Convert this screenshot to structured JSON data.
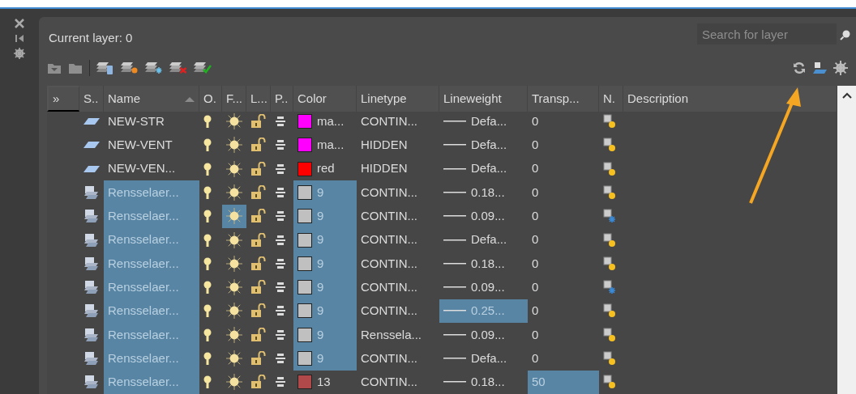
{
  "palette": {
    "current_layer": "Current layer: 0",
    "search": {
      "placeholder": "Search for layer"
    }
  },
  "table": {
    "columns": [
      {
        "label": "»",
        "kind": "expand"
      },
      {
        "label": "S..",
        "kind": "header"
      },
      {
        "label": "Name",
        "kind": "header",
        "sorted": true
      },
      {
        "label": "O.",
        "kind": "header"
      },
      {
        "label": "F...",
        "kind": "header"
      },
      {
        "label": "L...",
        "kind": "header"
      },
      {
        "label": "P..",
        "kind": "header"
      },
      {
        "label": "Color",
        "kind": "header"
      },
      {
        "label": "Linetype",
        "kind": "header"
      },
      {
        "label": "Lineweight",
        "kind": "header"
      },
      {
        "label": "Transp...",
        "kind": "header"
      },
      {
        "label": "N.",
        "kind": "header"
      },
      {
        "label": "Description",
        "kind": "header"
      }
    ],
    "rows": [
      {
        "kind": "layer",
        "name": "NEW-STR",
        "selected": false,
        "on": true,
        "frozen": false,
        "freeze_selected": false,
        "locked": false,
        "plot": true,
        "color": "#ff00ff",
        "color_name": "ma...",
        "color_selected": false,
        "linetype": "CONTIN...",
        "lineweight": "Defa...",
        "lineweight_selected": false,
        "transparency": "0",
        "transparency_selected": false,
        "vp_frozen": false
      },
      {
        "kind": "layer",
        "name": "NEW-VENT",
        "selected": false,
        "on": true,
        "frozen": false,
        "freeze_selected": false,
        "locked": false,
        "plot": true,
        "color": "#ff00ff",
        "color_name": "ma...",
        "color_selected": false,
        "linetype": "HIDDEN",
        "lineweight": "Defa...",
        "lineweight_selected": false,
        "transparency": "0",
        "transparency_selected": false,
        "vp_frozen": false
      },
      {
        "kind": "layer",
        "name": "NEW-VEN...",
        "selected": false,
        "on": true,
        "frozen": false,
        "freeze_selected": false,
        "locked": false,
        "plot": true,
        "color": "#ff0000",
        "color_name": "red",
        "color_selected": false,
        "linetype": "HIDDEN",
        "lineweight": "Defa...",
        "lineweight_selected": false,
        "transparency": "0",
        "transparency_selected": false,
        "vp_frozen": false
      },
      {
        "kind": "xref",
        "name": "Rensselaer...",
        "selected": true,
        "on": true,
        "frozen": false,
        "freeze_selected": false,
        "locked": false,
        "plot": true,
        "color": "#c0c0c0",
        "color_name": "9",
        "color_selected": true,
        "linetype": "CONTIN...",
        "lineweight": "0.18...",
        "lineweight_selected": false,
        "transparency": "0",
        "transparency_selected": false,
        "vp_frozen": false
      },
      {
        "kind": "xref",
        "name": "Rensselaer...",
        "selected": true,
        "on": true,
        "frozen": false,
        "freeze_selected": true,
        "locked": false,
        "plot": true,
        "color": "#c0c0c0",
        "color_name": "9",
        "color_selected": true,
        "linetype": "CONTIN...",
        "lineweight": "0.09...",
        "lineweight_selected": false,
        "transparency": "0",
        "transparency_selected": false,
        "vp_frozen": true
      },
      {
        "kind": "xref",
        "name": "Rensselaer...",
        "selected": true,
        "on": true,
        "frozen": false,
        "freeze_selected": false,
        "locked": false,
        "plot": true,
        "color": "#c0c0c0",
        "color_name": "9",
        "color_selected": true,
        "linetype": "CONTIN...",
        "lineweight": "Defa...",
        "lineweight_selected": false,
        "transparency": "0",
        "transparency_selected": false,
        "vp_frozen": false
      },
      {
        "kind": "xref",
        "name": "Rensselaer...",
        "selected": true,
        "on": true,
        "frozen": false,
        "freeze_selected": false,
        "locked": false,
        "plot": true,
        "color": "#c0c0c0",
        "color_name": "9",
        "color_selected": true,
        "linetype": "CONTIN...",
        "lineweight": "0.18...",
        "lineweight_selected": false,
        "transparency": "0",
        "transparency_selected": false,
        "vp_frozen": false
      },
      {
        "kind": "xref",
        "name": "Rensselaer...",
        "selected": true,
        "on": true,
        "frozen": false,
        "freeze_selected": false,
        "locked": false,
        "plot": true,
        "color": "#c0c0c0",
        "color_name": "9",
        "color_selected": true,
        "linetype": "CONTIN...",
        "lineweight": "0.09...",
        "lineweight_selected": false,
        "transparency": "0",
        "transparency_selected": false,
        "vp_frozen": true
      },
      {
        "kind": "xref",
        "name": "Rensselaer...",
        "selected": true,
        "on": true,
        "frozen": false,
        "freeze_selected": false,
        "locked": false,
        "plot": true,
        "color": "#c0c0c0",
        "color_name": "9",
        "color_selected": true,
        "linetype": "CONTIN...",
        "lineweight": "0.25...",
        "lineweight_selected": true,
        "transparency": "0",
        "transparency_selected": false,
        "vp_frozen": false
      },
      {
        "kind": "xref",
        "name": "Rensselaer...",
        "selected": true,
        "on": true,
        "frozen": false,
        "freeze_selected": false,
        "locked": false,
        "plot": true,
        "color": "#c0c0c0",
        "color_name": "9",
        "color_selected": true,
        "linetype": "Renssela...",
        "lineweight": "0.09...",
        "lineweight_selected": false,
        "transparency": "0",
        "transparency_selected": false,
        "vp_frozen": false
      },
      {
        "kind": "xref",
        "name": "Rensselaer...",
        "selected": true,
        "on": true,
        "frozen": false,
        "freeze_selected": false,
        "locked": false,
        "plot": true,
        "color": "#c0c0c0",
        "color_name": "9",
        "color_selected": true,
        "linetype": "CONTIN...",
        "lineweight": "Defa...",
        "lineweight_selected": false,
        "transparency": "0",
        "transparency_selected": false,
        "vp_frozen": false
      },
      {
        "kind": "xref",
        "name": "Rensselaer...",
        "selected": true,
        "on": true,
        "frozen": false,
        "freeze_selected": false,
        "locked": false,
        "plot": true,
        "color": "#b04a4a",
        "color_name": "13",
        "color_selected": false,
        "linetype": "CONTIN...",
        "lineweight": "0.18...",
        "lineweight_selected": false,
        "transparency": "50",
        "transparency_selected": true,
        "vp_frozen": false
      }
    ]
  }
}
